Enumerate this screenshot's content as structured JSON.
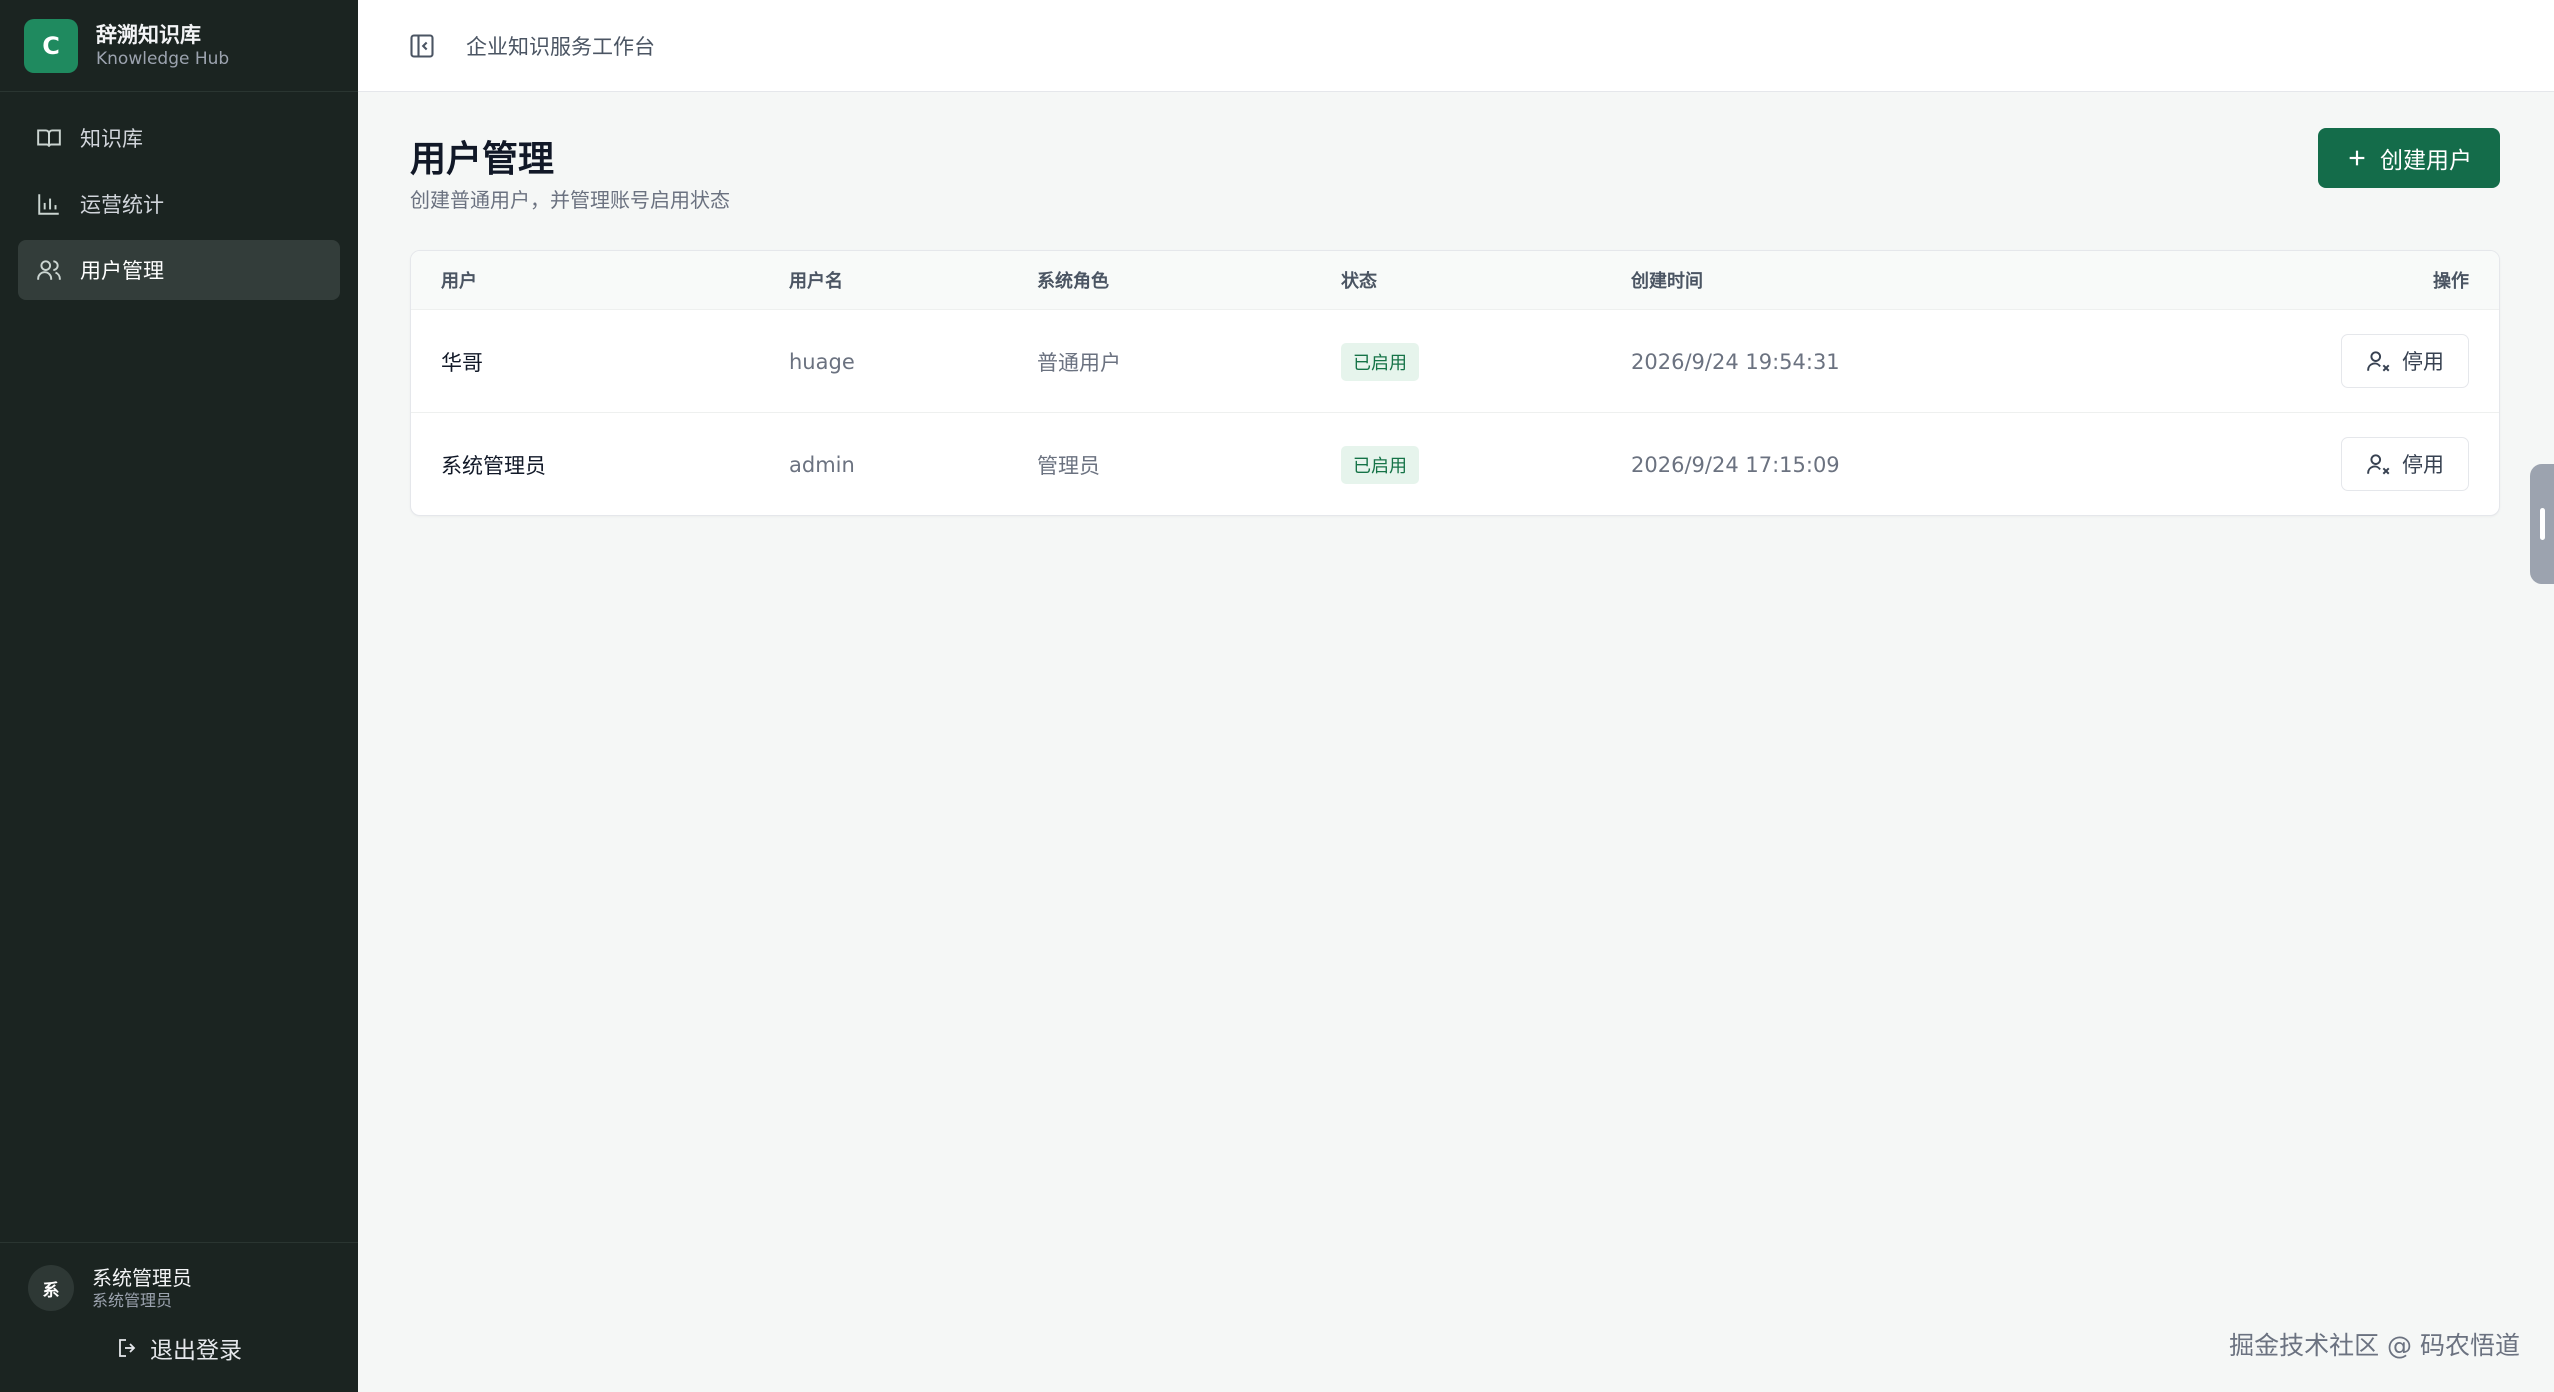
{
  "brand": {
    "logo_letter": "C",
    "title": "辞溯知识库",
    "subtitle": "Knowledge Hub"
  },
  "sidebar": {
    "items": [
      {
        "label": "知识库",
        "icon": "book-icon"
      },
      {
        "label": "运营统计",
        "icon": "bar-chart-icon"
      },
      {
        "label": "用户管理",
        "icon": "users-icon",
        "active": true
      }
    ],
    "user": {
      "avatar_text": "系",
      "name": "系统管理员",
      "role": "系统管理员"
    },
    "logout_label": "退出登录"
  },
  "topbar": {
    "title": "企业知识服务工作台"
  },
  "page": {
    "title": "用户管理",
    "description": "创建普通用户，并管理账号启用状态",
    "create_button": "创建用户"
  },
  "table": {
    "headers": {
      "user": "用户",
      "username": "用户名",
      "role": "系统角色",
      "status": "状态",
      "created": "创建时间",
      "action": "操作"
    },
    "rows": [
      {
        "user": "华哥",
        "username": "huage",
        "role": "普通用户",
        "status": "已启用",
        "created": "2026/9/24 19:54:31",
        "action": "停用"
      },
      {
        "user": "系统管理员",
        "username": "admin",
        "role": "管理员",
        "status": "已启用",
        "created": "2026/9/24 17:15:09",
        "action": "停用"
      }
    ]
  },
  "watermark": "掘金技术社区 @ 码农悟道",
  "colors": {
    "sidebar_bg": "#1b2421",
    "accent": "#146c4a",
    "badge_bg": "#e6f4ec",
    "badge_text": "#157347"
  }
}
